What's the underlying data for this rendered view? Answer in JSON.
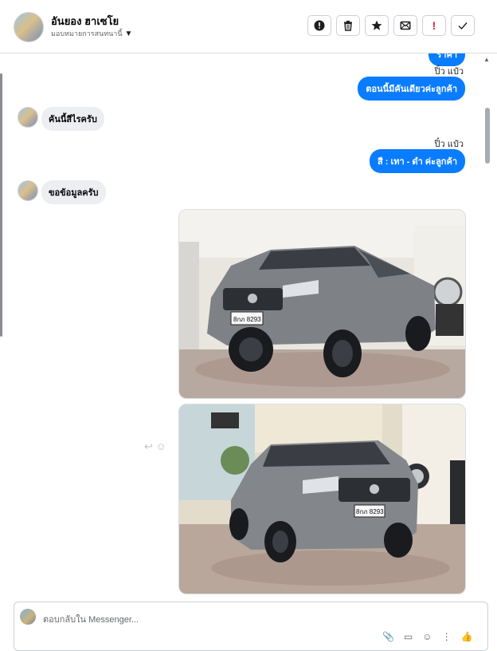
{
  "header": {
    "name": "อันยอง ฮาเซโย",
    "assign_label": "มอบหมายการสนทนานี้",
    "actions": [
      {
        "name": "spam-button",
        "icon": "exclamation-circle-icon",
        "label": "!"
      },
      {
        "name": "delete-button",
        "icon": "trash-icon"
      },
      {
        "name": "star-button",
        "icon": "star-icon"
      },
      {
        "name": "mark-unread-button",
        "icon": "envelope-icon"
      },
      {
        "name": "follow-up-button",
        "icon": "red-exclamation-icon",
        "label": "!"
      },
      {
        "name": "done-button",
        "icon": "check-icon"
      }
    ]
  },
  "messages": [
    {
      "dir": "out",
      "text": "ราคา"
    },
    {
      "dir": "out",
      "sender": "ปิ๋ว แป๋ว",
      "text": "ตอนนี้มีคันเดียวค่ะลูกค้า"
    },
    {
      "dir": "in",
      "text": "คันนี้สีไรครับ"
    },
    {
      "dir": "out",
      "sender": "ปิ๋ว แป๋ว",
      "text": "สี :   เทา - ดำ ค่ะลูกค้า"
    },
    {
      "dir": "in",
      "text": "ขอข้อมูลครับ"
    },
    {
      "dir": "in",
      "type": "photo",
      "plate": "8กภ 8293"
    },
    {
      "dir": "in",
      "type": "photo",
      "plate": "8กภ 8293"
    }
  ],
  "composer": {
    "placeholder": "ตอบกลับใน Messenger..."
  },
  "colors": {
    "accent": "#0a7cff",
    "incoming": "#eceef1",
    "danger": "#e41e3f"
  }
}
